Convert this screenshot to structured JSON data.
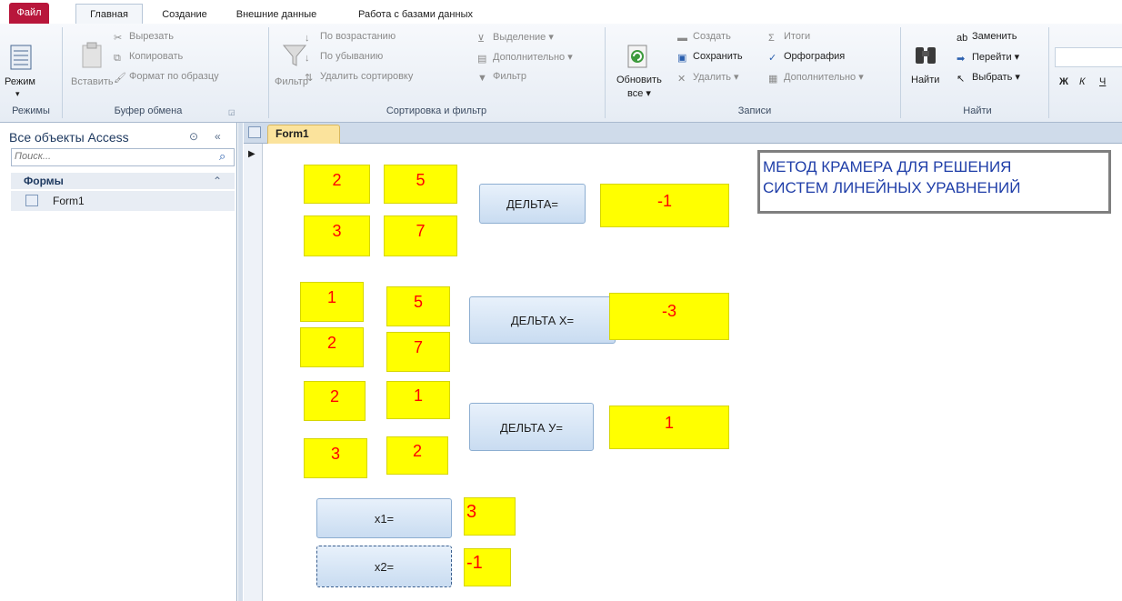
{
  "tabs": [
    "Файл",
    "Главная",
    "Создание",
    "Внешние данные",
    "Работа с базами данных"
  ],
  "ribbon": {
    "views": {
      "button": "Режим",
      "group": "Режимы"
    },
    "clipboard": {
      "paste": "Вставить",
      "cut": "Вырезать",
      "copy": "Копировать",
      "format_painter": "Формат по образцу",
      "group": "Буфер обмена"
    },
    "sort": {
      "filter": "Фильтр",
      "ascending": "По возрастанию",
      "descending": "По убыванию",
      "remove_sort": "Удалить сортировку",
      "selection": "Выделение",
      "advanced": "Дополнительно",
      "toggle_filter": "Фильтр",
      "group": "Сортировка и фильтр"
    },
    "records": {
      "refresh_line1": "Обновить",
      "refresh_line2": "все",
      "new": "Создать",
      "save": "Сохранить",
      "delete": "Удалить",
      "totals": "Итоги",
      "spelling": "Орфография",
      "more": "Дополнительно",
      "group": "Записи"
    },
    "find": {
      "find": "Найти",
      "replace": "Заменить",
      "goto": "Перейти",
      "select": "Выбрать",
      "group": "Найти"
    },
    "text": {
      "bold": "Ж",
      "italic": "К",
      "underline": "Ч"
    }
  },
  "nav": {
    "header": "Все объекты Access",
    "search_placeholder": "Поиск...",
    "section": "Формы",
    "items": [
      {
        "label": "Form1"
      }
    ]
  },
  "document": {
    "tab": "Form1"
  },
  "form": {
    "title_line1": "МЕТОД КРАМЕРА ДЛЯ РЕШЕНИЯ",
    "title_line2": "СИСТЕМ ЛИНЕЙНЫХ УРАВНЕНИЙ",
    "matrix1": [
      "2",
      "5",
      "3",
      "7"
    ],
    "matrix2": [
      "1",
      "5",
      "2",
      "7"
    ],
    "matrix3": [
      "2",
      "1",
      "3",
      "2"
    ],
    "delta_label": "ДЕЛЬТА=",
    "delta_value": "-1",
    "delta_x_label": "ДЕЛЬТА Х=",
    "delta_x_value": "-3",
    "delta_y_label": "ДЕЛЬТА У=",
    "delta_y_value": "1",
    "x1_label": "x1=",
    "x1_value": "3",
    "x2_label": "x2=",
    "x2_value": "-1"
  },
  "colors": {
    "field_bg": "#ffff00",
    "field_text": "#ff0000",
    "title_text": "#1f3ea8",
    "file_tab": "#b8163b"
  }
}
